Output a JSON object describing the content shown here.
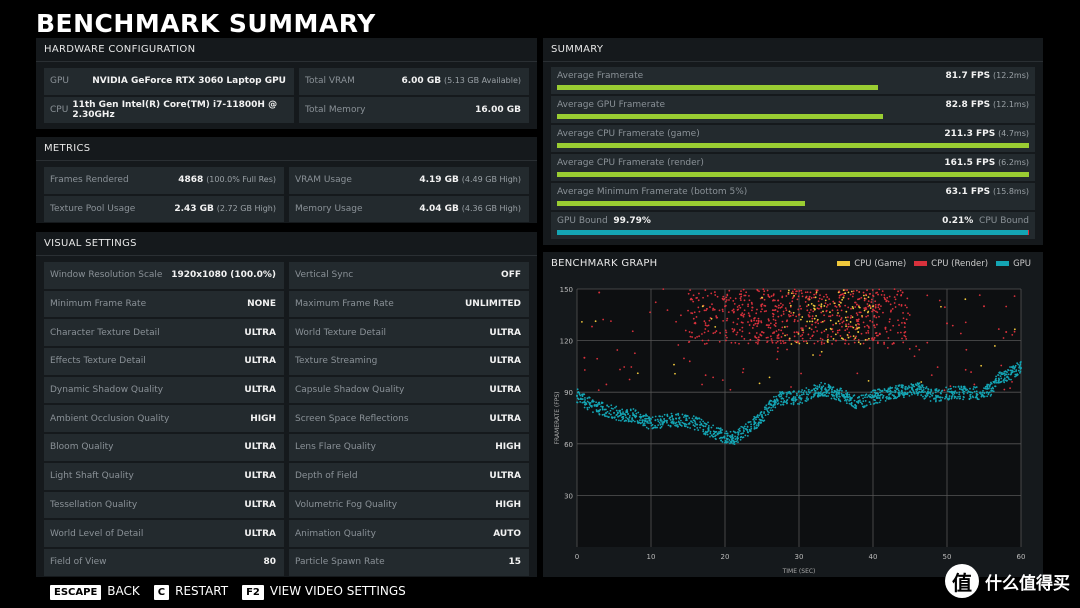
{
  "title": "BENCHMARK SUMMARY",
  "hardware": {
    "heading": "HARDWARE CONFIGURATION",
    "rows": [
      {
        "label": "GPU",
        "value": "NVIDIA GeForce RTX 3060 Laptop GPU",
        "sub": ""
      },
      {
        "label": "Total VRAM",
        "value": "6.00 GB",
        "sub": "(5.13 GB Available)"
      },
      {
        "label": "CPU",
        "value": "11th Gen Intel(R) Core(TM) i7-11800H @ 2.30GHz",
        "sub": ""
      },
      {
        "label": "Total Memory",
        "value": "16.00 GB",
        "sub": ""
      }
    ]
  },
  "metrics": {
    "heading": "METRICS",
    "rows": [
      {
        "label": "Frames Rendered",
        "value": "4868",
        "sub": "(100.0% Full Res)"
      },
      {
        "label": "VRAM Usage",
        "value": "4.19 GB",
        "sub": "(4.49 GB High)"
      },
      {
        "label": "Texture Pool Usage",
        "value": "2.43 GB",
        "sub": "(2.72 GB High)"
      },
      {
        "label": "Memory Usage",
        "value": "4.04 GB",
        "sub": "(4.36 GB High)"
      }
    ]
  },
  "visual": {
    "heading": "VISUAL SETTINGS",
    "rows": [
      {
        "label": "Window Resolution Scale",
        "value": "1920x1080 (100.0%)"
      },
      {
        "label": "Vertical Sync",
        "value": "OFF"
      },
      {
        "label": "Minimum Frame Rate",
        "value": "NONE"
      },
      {
        "label": "Maximum Frame Rate",
        "value": "UNLIMITED"
      },
      {
        "label": "Character Texture Detail",
        "value": "ULTRA"
      },
      {
        "label": "World Texture Detail",
        "value": "ULTRA"
      },
      {
        "label": "Effects Texture Detail",
        "value": "ULTRA"
      },
      {
        "label": "Texture Streaming",
        "value": "ULTRA"
      },
      {
        "label": "Dynamic Shadow Quality",
        "value": "ULTRA"
      },
      {
        "label": "Capsule Shadow Quality",
        "value": "ULTRA"
      },
      {
        "label": "Ambient Occlusion Quality",
        "value": "HIGH"
      },
      {
        "label": "Screen Space Reflections",
        "value": "ULTRA"
      },
      {
        "label": "Bloom Quality",
        "value": "ULTRA"
      },
      {
        "label": "Lens Flare Quality",
        "value": "HIGH"
      },
      {
        "label": "Light Shaft Quality",
        "value": "ULTRA"
      },
      {
        "label": "Depth of Field",
        "value": "ULTRA"
      },
      {
        "label": "Tessellation Quality",
        "value": "ULTRA"
      },
      {
        "label": "Volumetric Fog Quality",
        "value": "HIGH"
      },
      {
        "label": "World Level of Detail",
        "value": "ULTRA"
      },
      {
        "label": "Animation Quality",
        "value": "AUTO"
      },
      {
        "label": "Field of View",
        "value": "80"
      },
      {
        "label": "Particle Spawn Rate",
        "value": "15"
      }
    ]
  },
  "summary": {
    "heading": "SUMMARY",
    "rows": [
      {
        "label": "Average Framerate",
        "value": "81.7 FPS",
        "sub": "(12.2ms)",
        "fill": 0.68
      },
      {
        "label": "Average GPU Framerate",
        "value": "82.8 FPS",
        "sub": "(12.1ms)",
        "fill": 0.69
      },
      {
        "label": "Average CPU Framerate (game)",
        "value": "211.3 FPS",
        "sub": "(4.7ms)",
        "fill": 1.0
      },
      {
        "label": "Average CPU Framerate (render)",
        "value": "161.5 FPS",
        "sub": "(6.2ms)",
        "fill": 1.0
      },
      {
        "label": "Average Minimum Framerate (bottom 5%)",
        "value": "63.1 FPS",
        "sub": "(15.8ms)",
        "fill": 0.525
      }
    ],
    "bound": {
      "gpu_label": "GPU Bound",
      "gpu_value": "99.79%",
      "cpu_value": "0.21%",
      "cpu_label": "CPU Bound",
      "gpu_fraction": 0.9979
    }
  },
  "graph": {
    "heading": "BENCHMARK GRAPH"
  },
  "chart_data": {
    "type": "scatter",
    "xlabel": "TIME (SEC)",
    "ylabel": "FRAMERATE (FPS)",
    "xlim": [
      0,
      60
    ],
    "ylim": [
      0,
      150
    ],
    "xticks": [
      0,
      10,
      20,
      30,
      40,
      50,
      60
    ],
    "yticks": [
      30,
      60,
      90,
      120,
      150
    ],
    "grid": true,
    "legend": "top-right",
    "series": [
      {
        "name": "CPU (Game)",
        "color": "#f0c83c",
        "points": [
          [
            17,
            140
          ],
          [
            25,
            145
          ],
          [
            30,
            135
          ],
          [
            33,
            140
          ],
          [
            35,
            130
          ],
          [
            36,
            145
          ],
          [
            38,
            125
          ],
          [
            40,
            140
          ]
        ]
      },
      {
        "name": "CPU (Render)",
        "color": "#d9313c",
        "points": [
          [
            1,
            110
          ],
          [
            3,
            148
          ],
          [
            16,
            130
          ],
          [
            20,
            140
          ],
          [
            25,
            125
          ],
          [
            30,
            135
          ],
          [
            35,
            120
          ],
          [
            40,
            138
          ],
          [
            44,
            148
          ],
          [
            50,
            130
          ],
          [
            55,
            140
          ],
          [
            58,
            125
          ]
        ]
      },
      {
        "name": "GPU",
        "color": "#14a5b4",
        "points": [
          [
            0,
            88
          ],
          [
            2,
            82
          ],
          [
            5,
            78
          ],
          [
            8,
            76
          ],
          [
            10,
            72
          ],
          [
            13,
            74
          ],
          [
            16,
            72
          ],
          [
            19,
            66
          ],
          [
            21,
            63
          ],
          [
            23,
            68
          ],
          [
            25,
            76
          ],
          [
            27,
            86
          ],
          [
            30,
            87
          ],
          [
            33,
            92
          ],
          [
            36,
            88
          ],
          [
            38,
            84
          ],
          [
            40,
            87
          ],
          [
            43,
            90
          ],
          [
            46,
            92
          ],
          [
            48,
            88
          ],
          [
            51,
            90
          ],
          [
            54,
            89
          ],
          [
            56,
            92
          ],
          [
            57,
            98
          ],
          [
            60,
            104
          ]
        ]
      }
    ]
  },
  "footer": [
    {
      "key": "ESCAPE",
      "label": "BACK"
    },
    {
      "key": "C",
      "label": "RESTART"
    },
    {
      "key": "F2",
      "label": "VIEW VIDEO SETTINGS"
    }
  ],
  "watermark": {
    "glyph": "值",
    "text": "什么值得买"
  }
}
